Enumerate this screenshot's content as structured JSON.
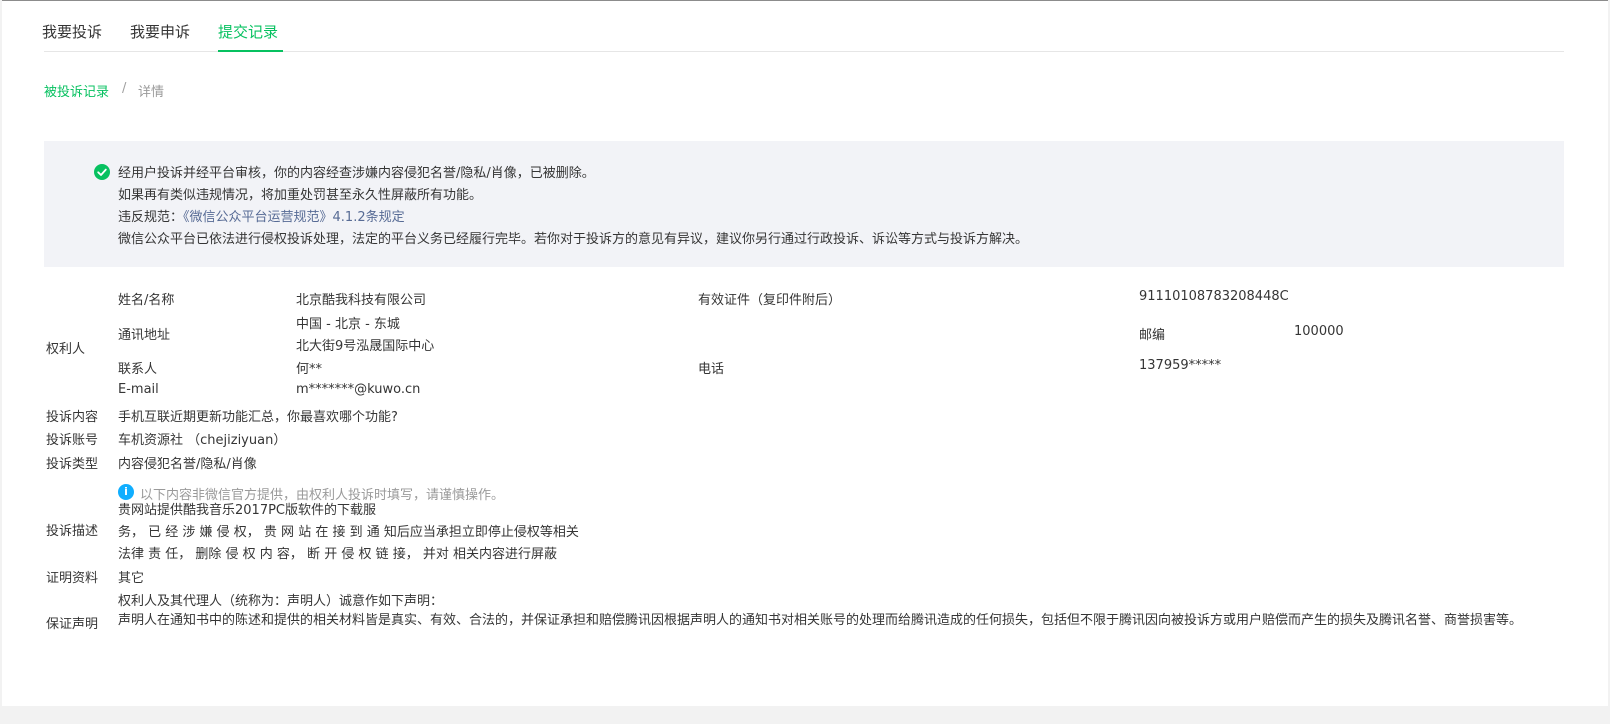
{
  "tabs": [
    {
      "label": "我要投诉",
      "active": false
    },
    {
      "label": "我要申诉",
      "active": false
    },
    {
      "label": "提交记录",
      "active": true
    }
  ],
  "breadcrumb": {
    "parent": "被投诉记录",
    "sep": "/",
    "current": "详情"
  },
  "notice": {
    "line1": "经用户投诉并经平台审核，你的内容经查涉嫌内容侵犯名誉/隐私/肖像，已被删除。",
    "line2": "如果再有类似违规情况，将加重处罚甚至永久性屏蔽所有功能。",
    "rule_prefix": "违反规范：",
    "rule_link": "《微信公众平台运营规范》4.1.2条规定",
    "line4": "微信公众平台已依法进行侵权投诉处理，法定的平台义务已经履行完毕。若你对于投诉方的意见有异议，建议你另行通过行政投诉、诉讼等方式与投诉方解决。"
  },
  "rights_holder": {
    "section_label": "权利人",
    "name_label": "姓名/名称",
    "name_value": "北京酷我科技有限公司",
    "cert_label": "有效证件（复印件附后）",
    "cert_value": "91110108783208448C",
    "addr_label": "通讯地址",
    "addr_line1": "中国 - 北京 - 东城",
    "addr_line2": "北大街9号泓晟国际中心",
    "zip_label": "邮编",
    "zip_value": "100000",
    "contact_label": "联系人",
    "contact_value": "何**",
    "phone_label": "电话",
    "phone_value": "137959*****",
    "email_label": "E-mail",
    "email_value": "m*******@kuwo.cn"
  },
  "complaint": {
    "content_label": "投诉内容",
    "content_value": "手机互联近期更新功能汇总，你最喜欢哪个功能?",
    "account_label": "投诉账号",
    "account_value": "车机资源社 （chejiziyuan）",
    "type_label": "投诉类型",
    "type_value": "内容侵犯名誉/隐私/肖像",
    "hint": "以下内容非微信官方提供，由权利人投诉时填写，请谨慎操作。",
    "desc_label": "投诉描述",
    "desc_line1": "贵网站提供酷我音乐2017PC版软件的下载服",
    "desc_line2": "务， 已 经 涉 嫌 侵 权， 贵 网 站 在 接 到 通 知后应当承担立即停止侵权等相关",
    "desc_line3": "法律 责 任， 删除 侵 权 内 容， 断 开 侵 权 链 接， 并对 相关内容进行屏蔽",
    "proof_label": "证明资料",
    "proof_value": "其它",
    "guarantee_label": "保证声明",
    "guarantee_line1": "权利人及其代理人（统称为：声明人）诚意作如下声明：",
    "guarantee_line2": "声明人在通知书中的陈述和提供的相关材料皆是真实、有效、合法的，并保证承担和赔偿腾讯因根据声明人的通知书对相关账号的处理而给腾讯造成的任何损失，包括但不限于腾讯因向被投诉方或用户赔偿而产生的损失及腾讯名誉、商誉损害等。"
  },
  "colors": {
    "accent": "#07c160",
    "link": "#576b95",
    "info": "#10aeff"
  }
}
